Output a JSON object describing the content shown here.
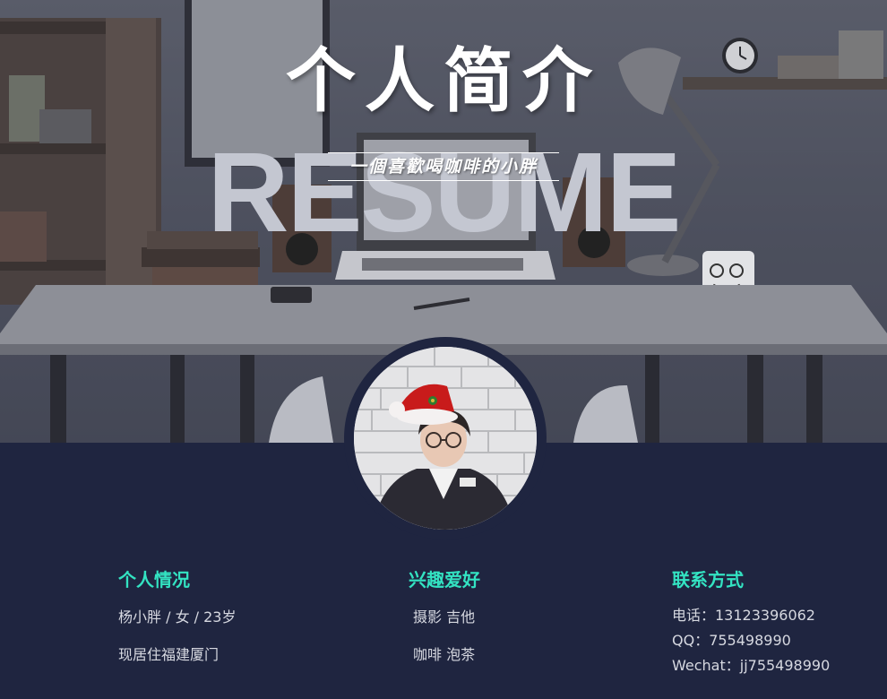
{
  "hero": {
    "title": "个人简介",
    "resume": "RESUME",
    "tagline": "一個喜歡喝咖啡的小胖"
  },
  "colors": {
    "background": "#1f2540",
    "heading": "#33e3c2",
    "body_text": "#d6d8e0"
  },
  "sections": {
    "personal": {
      "heading": "个人情况",
      "lines": [
        "杨小胖 / 女 / 23岁",
        "现居住福建厦门"
      ]
    },
    "hobbies": {
      "heading": "兴趣爱好",
      "lines": [
        "摄影 吉他",
        "咖啡 泡茶"
      ]
    },
    "contact": {
      "heading": "联系方式",
      "lines": [
        "电话：13123396062",
        "QQ：755498990",
        "Wechat：jj755498990"
      ]
    }
  }
}
